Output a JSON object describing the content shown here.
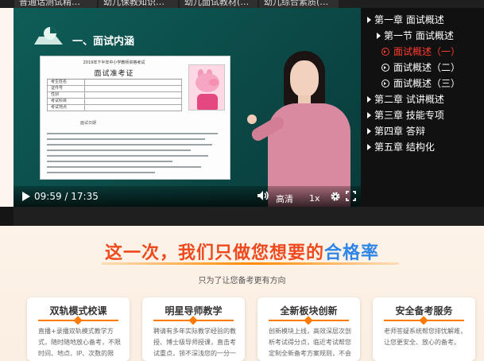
{
  "course_tabs": [
    "普通话测试精…",
    "幼儿保教知识…",
    "幼儿面试教材(…",
    "幼儿综合素质(…"
  ],
  "video": {
    "slide_heading": "一、面试内涵",
    "ticket": {
      "top_line": "2019年下半年中小学教师资格考试",
      "title": "面试准考证",
      "row_labels": [
        "考生姓名",
        "证件号",
        "性别",
        "考试科目",
        "考试地点"
      ],
      "signature_left": "面试日期"
    }
  },
  "controls": {
    "current_time": "09:59",
    "duration": "17:35",
    "time_display": "09:59 / 17:35",
    "quality": "高清",
    "speed": "1x"
  },
  "sidebar": {
    "items": [
      {
        "label": "第一章 面试概述",
        "icon": "triangle-icon",
        "level": 0,
        "active": false
      },
      {
        "label": "第一节 面试概述",
        "icon": "triangle-icon",
        "level": 1,
        "active": false
      },
      {
        "label": "面试概述（一）",
        "icon": "play-circle-icon",
        "level": 2,
        "active": true
      },
      {
        "label": "面试概述（二）",
        "icon": "play-circle-icon",
        "level": 2,
        "active": false
      },
      {
        "label": "面试概述（三）",
        "icon": "play-circle-icon",
        "level": 2,
        "active": false
      },
      {
        "label": "第二章 试讲概述",
        "icon": "triangle-icon",
        "level": 0,
        "active": false
      },
      {
        "label": "第三章 技能专项",
        "icon": "triangle-icon",
        "level": 0,
        "active": false
      },
      {
        "label": "第四章 答辩",
        "icon": "triangle-icon",
        "level": 0,
        "active": false
      },
      {
        "label": "第五章 结构化",
        "icon": "triangle-icon",
        "level": 0,
        "active": false
      }
    ]
  },
  "promo": {
    "headline_main": "这一次，我们只做您想要的",
    "headline_highlight": "合格率",
    "subtitle": "只为了让您备考更有方向",
    "cards": [
      {
        "title": "双轨模式校课",
        "text": "直播+录播双轨模式教学方式，随时随地放心备考，不限时间、地点、IP、次数的限制。"
      },
      {
        "title": "明星导师教学",
        "text": "聘请有多年实际教学经验的教授、博士级导师授课，直击考试重点，领不深浅您的一分一"
      },
      {
        "title": "全新板块创新",
        "text": "创新模块上线，高效深层次剖析考试得分点，临近考试帮您定制全新备考方案规则，不会"
      },
      {
        "title": "安全备考服务",
        "text": "老师答疑系统帮您排忧解难，让您更安全、放心的备考。"
      }
    ]
  },
  "colors": {
    "active_chapter": "#ff3b2f",
    "headline": "#ef4a1f",
    "headline_highlight": "#2f86e6",
    "card_accent": "#ff7a00"
  }
}
